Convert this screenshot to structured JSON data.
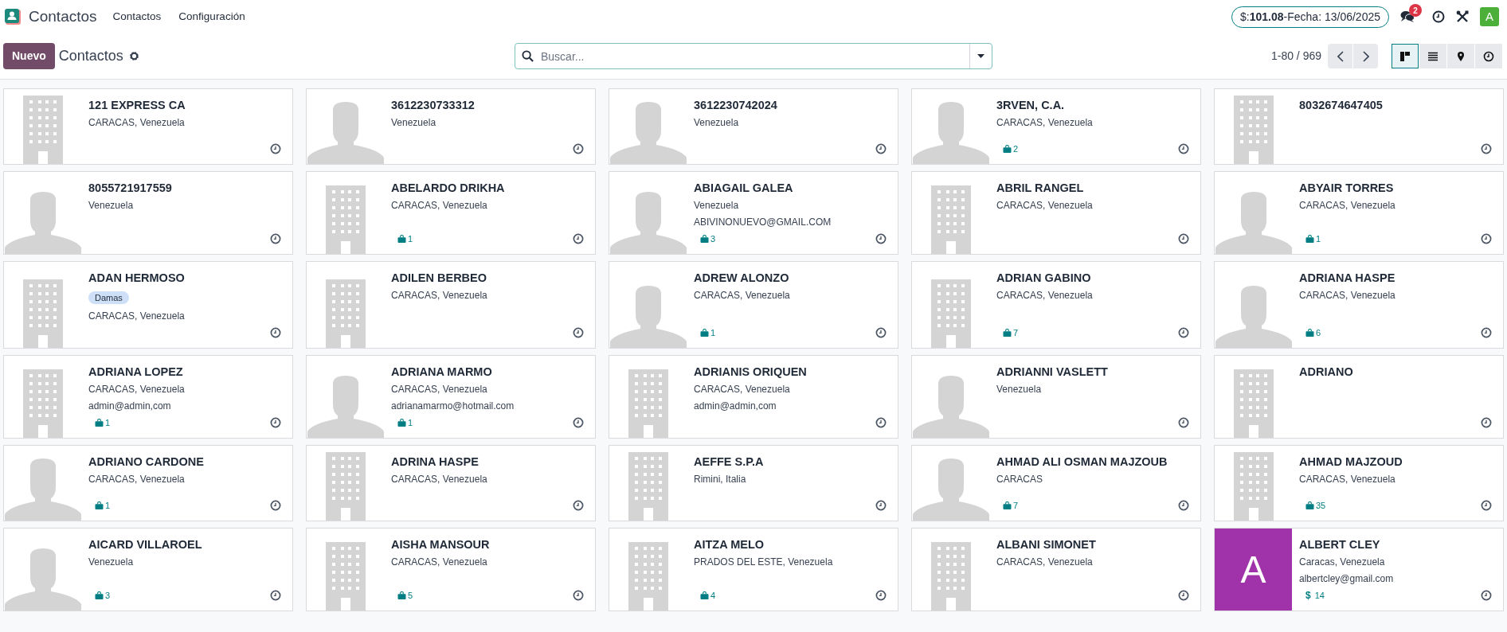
{
  "navbar": {
    "app_name": "Contactos",
    "menu": [
      "Contactos",
      "Configuración"
    ],
    "rate_pill": "$:**101.08**-Fecha: 13/06/2025",
    "messages_count": "2",
    "avatar_initial": "A"
  },
  "control_panel": {
    "new_button": "Nuevo",
    "breadcrumb": "Contactos",
    "search": {
      "placeholder": "Buscar..."
    },
    "pager": "1-80 / 969",
    "views": [
      {
        "kind": "kanban",
        "selected": true
      },
      {
        "kind": "list",
        "selected": false
      },
      {
        "kind": "map",
        "selected": false
      },
      {
        "kind": "activity",
        "selected": false
      }
    ]
  },
  "cards": [
    {
      "name": "121 EXPRESS CA",
      "kind": "company",
      "lines": [
        "CARACAS, Venezuela"
      ]
    },
    {
      "name": "3612230733312",
      "kind": "person",
      "lines": [
        "Venezuela"
      ]
    },
    {
      "name": "3612230742024",
      "kind": "person",
      "lines": [
        "Venezuela"
      ]
    },
    {
      "name": "3RVEN, C.A.",
      "kind": "person",
      "lines": [
        "CARACAS, Venezuela"
      ],
      "badge": {
        "kind": "sales",
        "count": "2"
      }
    },
    {
      "name": "8032674647405",
      "kind": "company"
    },
    {
      "name": "8055721917559",
      "kind": "person",
      "lines": [
        "Venezuela"
      ]
    },
    {
      "name": "ABELARDO DRIKHA",
      "kind": "company",
      "lines": [
        "CARACAS, Venezuela"
      ],
      "badge": {
        "kind": "sales",
        "count": "1"
      }
    },
    {
      "name": "ABIAGAIL GALEA",
      "kind": "person",
      "lines": [
        "Venezuela",
        "ABIVINONUEVO@GMAIL.COM"
      ],
      "badge": {
        "kind": "sales",
        "count": "3"
      }
    },
    {
      "name": "ABRIL RANGEL",
      "kind": "company",
      "lines": [
        "CARACAS, Venezuela"
      ]
    },
    {
      "name": "ABYAIR TORRES",
      "kind": "person",
      "lines": [
        "CARACAS, Venezuela"
      ],
      "badge": {
        "kind": "sales",
        "count": "1"
      }
    },
    {
      "name": "ADAN HERMOSO",
      "kind": "company",
      "tags": [
        "Damas"
      ],
      "lines": [
        "CARACAS, Venezuela"
      ]
    },
    {
      "name": "ADILEN BERBEO",
      "kind": "company",
      "lines": [
        "CARACAS, Venezuela"
      ]
    },
    {
      "name": "ADREW ALONZO",
      "kind": "person",
      "lines": [
        "CARACAS, Venezuela"
      ],
      "badge": {
        "kind": "sales",
        "count": "1"
      }
    },
    {
      "name": "ADRIAN GABINO",
      "kind": "company",
      "lines": [
        "CARACAS, Venezuela"
      ],
      "badge": {
        "kind": "sales",
        "count": "7"
      }
    },
    {
      "name": "ADRIANA HASPE",
      "kind": "person",
      "lines": [
        "CARACAS, Venezuela"
      ],
      "badge": {
        "kind": "sales",
        "count": "6"
      }
    },
    {
      "name": "ADRIANA LOPEZ",
      "kind": "company",
      "lines": [
        "CARACAS, Venezuela",
        "admin@admin,com"
      ],
      "badge": {
        "kind": "sales",
        "count": "1"
      }
    },
    {
      "name": "ADRIANA MARMO",
      "kind": "person",
      "lines": [
        "CARACAS, Venezuela",
        "adrianamarmo@hotmail.com"
      ],
      "badge": {
        "kind": "sales",
        "count": "1"
      }
    },
    {
      "name": "ADRIANIS ORIQUEN",
      "kind": "company",
      "lines": [
        "CARACAS, Venezuela",
        "admin@admin,com"
      ]
    },
    {
      "name": "ADRIANNI VASLETT",
      "kind": "person",
      "lines": [
        "Venezuela"
      ]
    },
    {
      "name": "ADRIANO",
      "kind": "company"
    },
    {
      "name": "ADRIANO CARDONE",
      "kind": "person",
      "lines": [
        "CARACAS, Venezuela"
      ],
      "badge": {
        "kind": "sales",
        "count": "1"
      }
    },
    {
      "name": "ADRINA HASPE",
      "kind": "company",
      "lines": [
        "CARACAS, Venezuela"
      ]
    },
    {
      "name": "AEFFE S.P.A",
      "kind": "company",
      "lines": [
        "Rimini, Italia"
      ]
    },
    {
      "name": "AHMAD ALI OSMAN MAJZOUB",
      "kind": "person",
      "lines": [
        "CARACAS"
      ],
      "badge": {
        "kind": "sales",
        "count": "7"
      }
    },
    {
      "name": "AHMAD MAJZOUD",
      "kind": "company",
      "lines": [
        "CARACAS, Venezuela"
      ],
      "badge": {
        "kind": "sales",
        "count": "35"
      }
    },
    {
      "name": "AICARD VILLAROEL",
      "kind": "person",
      "lines": [
        "Venezuela"
      ],
      "badge": {
        "kind": "sales",
        "count": "3"
      }
    },
    {
      "name": "AISHA MANSOUR",
      "kind": "company",
      "lines": [
        "CARACAS, Venezuela"
      ],
      "badge": {
        "kind": "sales",
        "count": "5"
      }
    },
    {
      "name": "AITZA MELO",
      "kind": "company",
      "lines": [
        "PRADOS DEL ESTE, Venezuela"
      ],
      "badge": {
        "kind": "sales",
        "count": "4"
      }
    },
    {
      "name": "ALBANI SIMONET",
      "kind": "company",
      "lines": [
        "CARACAS, Venezuela"
      ]
    },
    {
      "name": "ALBERT CLEY",
      "kind": "initial",
      "initial": "A",
      "color": "#a033a9",
      "lines": [
        "Caracas, Venezuela",
        "albertcley@gmail.com"
      ],
      "badge": {
        "kind": "money",
        "icon": "$",
        "count": "14"
      }
    }
  ]
}
